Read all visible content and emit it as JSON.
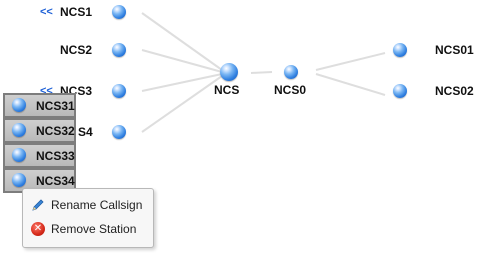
{
  "nodes": {
    "ncs1": "NCS1",
    "ncs2": "NCS2",
    "ncs3": "NCS3",
    "ncs4_partial": "S4",
    "ncs": "NCS",
    "ncs0": "NCS0",
    "ncs01": "NCS01",
    "ncs02": "NCS02"
  },
  "collapse_label": "<<",
  "stack": {
    "items": [
      "NCS31",
      "NCS32",
      "NCS33",
      "NCS34"
    ]
  },
  "context_menu": {
    "rename_label": "Rename Callsign",
    "remove_label": "Remove Station"
  },
  "icons": {
    "node": "blue-sphere-icon",
    "rename": "pencil-icon",
    "remove": "remove-circle-icon"
  },
  "colors": {
    "edge": "#dedede",
    "collapse": "#1c5fd6",
    "stack_bg": "#c4c4c4",
    "remove": "#d52a1a"
  }
}
